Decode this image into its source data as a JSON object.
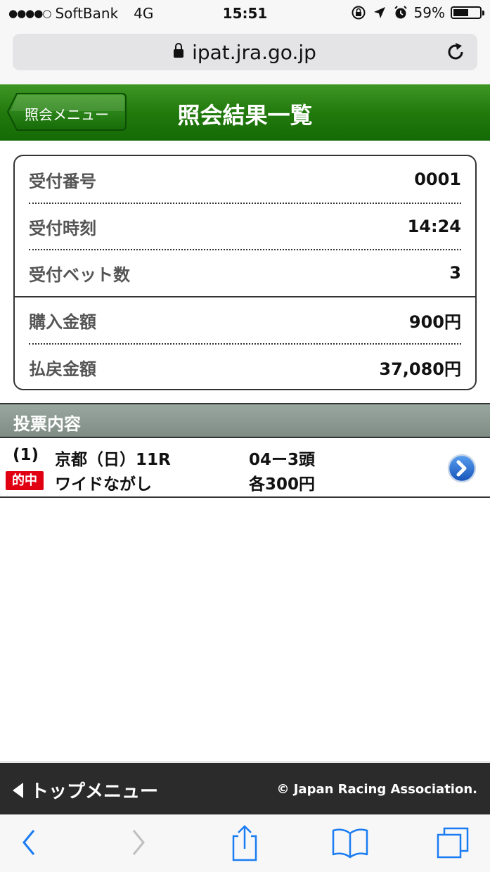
{
  "status_bar": {
    "signal_dots": "●●●●○",
    "carrier": "SoftBank",
    "network": "4G",
    "time": "15:51",
    "battery_percent": "59%",
    "battery_level": 0.59
  },
  "browser": {
    "url": "ipat.jra.go.jp"
  },
  "header": {
    "back_label": "照会メニュー",
    "title": "照会結果一覧"
  },
  "summary": [
    {
      "label": "受付番号",
      "value": "0001"
    },
    {
      "label": "受付時刻",
      "value": "14:24"
    },
    {
      "label": "受付ベット数",
      "value": "3"
    },
    {
      "label": "購入金額",
      "value": "900円"
    },
    {
      "label": "払戻金額",
      "value": "37,080円"
    }
  ],
  "section": {
    "title": "投票内容"
  },
  "bets": [
    {
      "number": "(1)",
      "race": "京都（日）11R",
      "selection": "04ー3頭",
      "status": "的中",
      "bet_type": "ワイドながし",
      "amount": "各300円"
    }
  ],
  "footer": {
    "top_menu_label": "トップメニュー",
    "copyright": "© Japan Racing Association."
  },
  "colors": {
    "header_green": "#227a0d",
    "hit_red": "#e00012",
    "ios_blue": "#1a7cf2"
  }
}
